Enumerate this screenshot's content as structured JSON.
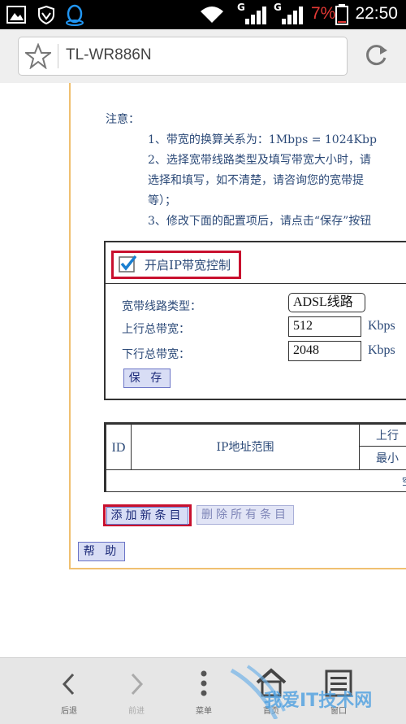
{
  "status_bar": {
    "time": "22:50",
    "battery_percent": "7%",
    "network_labels": [
      "G",
      "G"
    ]
  },
  "browser": {
    "url": "TL-WR886N"
  },
  "notes": {
    "heading": "注意：",
    "line1": "1、带宽的换算关系为：1Mbps = 1024Kbp",
    "line2": "2、选择宽带线路类型及填写带宽大小时，请",
    "line3": "选择和填写，如不清楚，请咨询您的宽带提",
    "line4": "等）；",
    "line5": "3、修改下面的配置项后，请点击“保存”按钮"
  },
  "bandwidth_control": {
    "enable_label": "开启IP带宽控制",
    "enabled": true,
    "line_type_label": "宽带线路类型：",
    "line_type_value": "ADSL线路",
    "upload_label": "上行总带宽：",
    "upload_value": "512",
    "upload_unit": "Kbps",
    "download_label": "下行总带宽：",
    "download_value": "2048",
    "download_unit": "Kbps",
    "save_label": "保 存"
  },
  "rules_table": {
    "col_id": "ID",
    "col_ip_range": "IP地址范围",
    "col_upload": "上行",
    "col_upload_min": "最小",
    "empty_text": "空"
  },
  "actions": {
    "add_label": "添加新条目",
    "delete_all_label": "删除所有条目",
    "help_label": "帮 助"
  },
  "bottom_nav": {
    "back_label": "后退",
    "forward_label": "前进",
    "menu_label": "菜单",
    "home_label": "首页",
    "multi_label": "窗口"
  },
  "colors": {
    "highlight": "#c8102e",
    "frame_border": "#f0c070",
    "text_blue": "#2c4a78",
    "battery_low": "#e53935"
  },
  "watermark": "我爱IT技术网"
}
